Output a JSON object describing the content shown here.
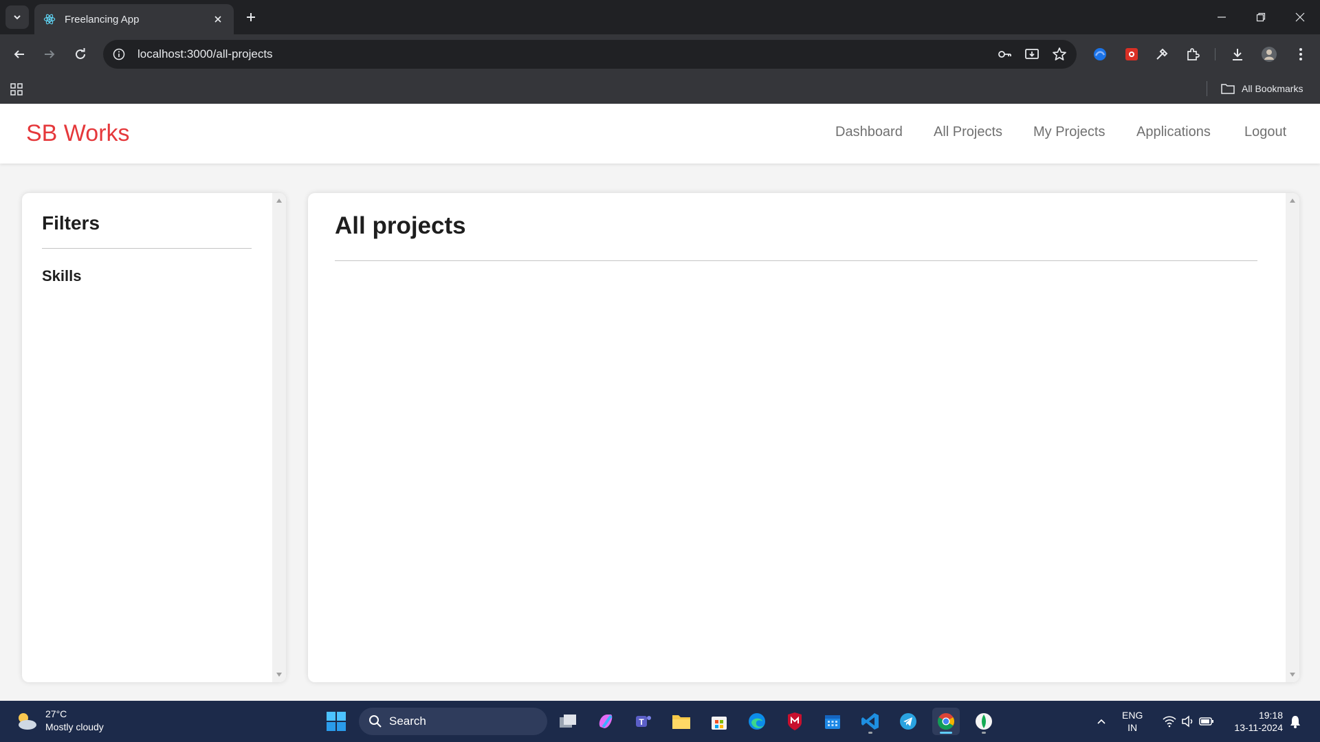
{
  "browser": {
    "tab_title": "Freelancing App",
    "url": "localhost:3000/all-projects",
    "bookmarks_label": "All Bookmarks"
  },
  "app": {
    "brand": "SB Works",
    "brand_color": "#e5383b",
    "nav": [
      "Dashboard",
      "All Projects",
      "My Projects",
      "Applications",
      "Logout"
    ],
    "filters": {
      "title": "Filters",
      "skills_label": "Skills"
    },
    "projects": {
      "title": "All projects"
    }
  },
  "taskbar": {
    "weather_temp": "27°C",
    "weather_desc": "Mostly cloudy",
    "search_label": "Search",
    "lang_top": "ENG",
    "lang_bottom": "IN",
    "time": "19:18",
    "date": "13-11-2024"
  }
}
